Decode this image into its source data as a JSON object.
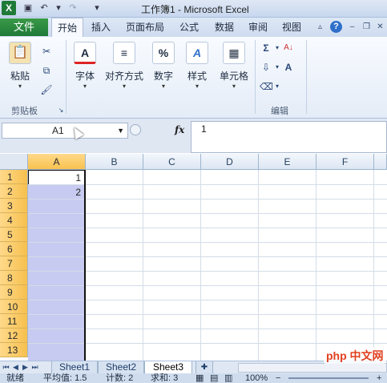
{
  "titlebar": {
    "title": "工作簿1 - Microsoft Excel",
    "logo": "X",
    "quick_access": [
      "save-icon",
      "undo-icon",
      "redo-icon"
    ]
  },
  "ribbon_tabs": {
    "file": "文件",
    "tabs": [
      "开始",
      "插入",
      "页面布局",
      "公式",
      "数据",
      "审阅",
      "视图"
    ],
    "active": "开始"
  },
  "ribbon": {
    "clipboard": {
      "paste": "粘贴",
      "group_label": "剪贴板"
    },
    "font": {
      "label": "字体",
      "icon_glyph": "A"
    },
    "align": {
      "label": "对齐方式",
      "icon_glyph": "≡"
    },
    "number": {
      "label": "数字",
      "icon_glyph": "%"
    },
    "styles": {
      "label": "样式",
      "icon_glyph": "A"
    },
    "cells": {
      "label": "单元格",
      "icon_glyph": "▦"
    },
    "editing": {
      "label": "编辑",
      "sum_glyph": "Σ",
      "sort_glyph": "A↓",
      "find_glyph": "A"
    }
  },
  "formula_bar": {
    "cell_ref": "A1",
    "fx": "fx",
    "content": "1"
  },
  "grid": {
    "columns": [
      "A",
      "B",
      "C",
      "D",
      "E",
      "F"
    ],
    "selected_column": "A",
    "rows": [
      "1",
      "2",
      "3",
      "4",
      "5",
      "6",
      "7",
      "8",
      "9",
      "10",
      "11",
      "12",
      "13"
    ],
    "cells": [
      {
        "ref": "A1",
        "value": "1"
      },
      {
        "ref": "A2",
        "value": "2"
      }
    ]
  },
  "sheets": {
    "tabs": [
      "Sheet1",
      "Sheet2",
      "Sheet3"
    ],
    "active": "Sheet3"
  },
  "status": {
    "ready": "就绪",
    "average": "平均值: 1.5",
    "count": "计数: 2",
    "sum": "求和: 3",
    "zoom": "100%"
  },
  "watermark": "php 中文网",
  "colors": {
    "excel_green": "#1f7a38",
    "selected_column": "#c7cbf1",
    "header_highlight": "#f8c250"
  }
}
